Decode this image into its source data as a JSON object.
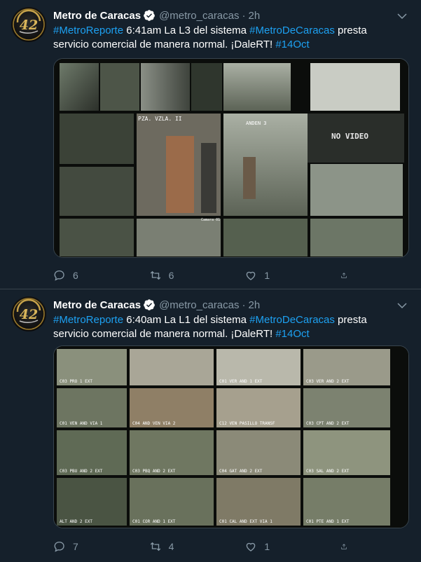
{
  "tweets": [
    {
      "name": "Metro de Caracas",
      "handle": "@metro_caracas",
      "separator": "·",
      "time": "2h",
      "avatar_text": "42",
      "text": {
        "hashtag1": "#MetroReporte",
        "part1": " 6:41am La L3 del sistema ",
        "hashtag2": "#MetroDeCaracas",
        "part2": " presta servicio comercial de manera normal. ¡DaleRT! ",
        "hashtag3": "#14Oct"
      },
      "media_labels": {
        "l1": "PZA. VZLA. II",
        "l2": "ANDEN 3",
        "l3": "NO VIDEO",
        "l4": "Camara 01"
      },
      "replies": "6",
      "retweets": "6",
      "likes": "1"
    },
    {
      "name": "Metro de Caracas",
      "handle": "@metro_caracas",
      "separator": "·",
      "time": "2h",
      "avatar_text": "42",
      "text": {
        "hashtag1": "#MetroReporte",
        "part1": " 6:40am La L1 del sistema ",
        "hashtag2": "#MetroDeCaracas",
        "part2": " presta servicio comercial de manera normal. ¡DaleRT! ",
        "hashtag3": "#14Oct"
      },
      "media_labels": {
        "c1": "C03 PRO 1 EXT",
        "c2": "C01 VER AND 1 EXT",
        "c3": "C03 VER AND 2 EXT",
        "c4": "C01 VEN AND VIA 1",
        "c5": "C04 AND VEN VIA 2",
        "c6": "C12 VEN PASILLO TRANSF",
        "c7": "C03 CPT AND 2 EXT",
        "c8": "C03 PBQ AND 2 EXT",
        "c9": "C04 GAT AND 2 EXT",
        "c10": "C03 SAL AND 2 EXT",
        "c11": "C01 COR AND 1 EXT",
        "c12": "C01 CAL AND EXT VIA 1",
        "c13": "C01 PTE AND 1 EXT",
        "c14": "ALT AND 2 EXT",
        "c15": "C03 PBU AND 2 EXT"
      },
      "replies": "7",
      "retweets": "4",
      "likes": "1"
    }
  ],
  "colors": {
    "background": "#15202b",
    "link": "#1da1f2",
    "muted": "#8899a6",
    "divider": "#38444d",
    "verified": "#ffffff"
  },
  "icons": [
    "avatar-logo",
    "verified-badge-icon",
    "chevron-down-icon",
    "reply-icon",
    "retweet-icon",
    "like-icon",
    "share-icon"
  ]
}
